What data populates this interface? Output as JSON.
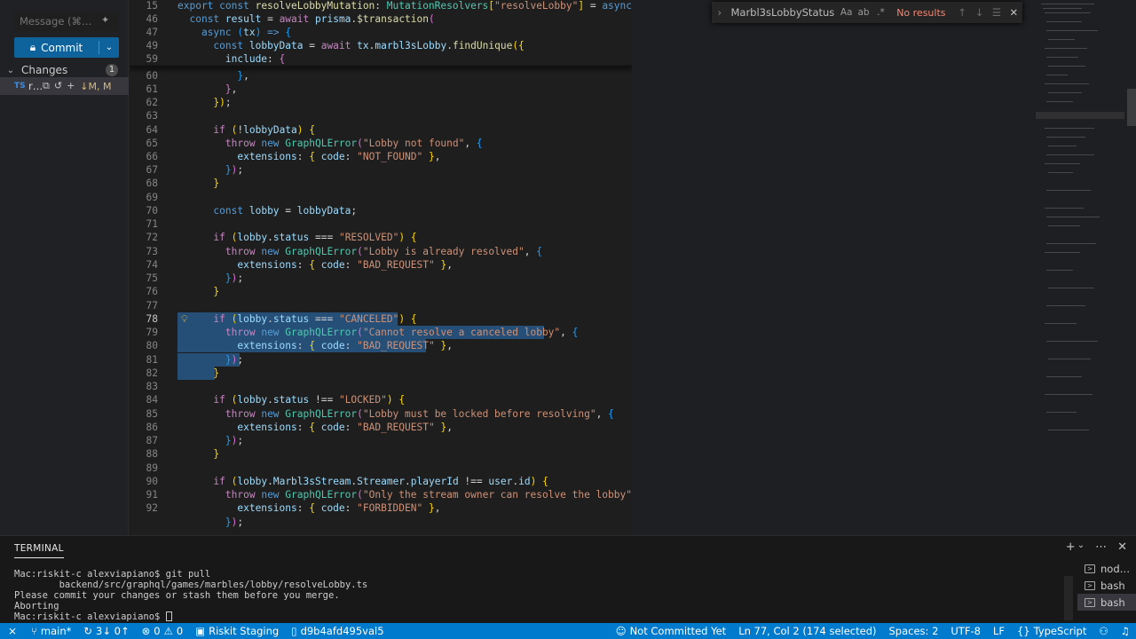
{
  "scm": {
    "message_placeholder": "Message (⌘…",
    "commit_label": "Commit",
    "changes_label": "Changes",
    "changes_count": "1",
    "file": {
      "lang": "TS",
      "name": "r…",
      "status": "↓M, M"
    }
  },
  "find": {
    "query": "Marbl3sLobbyStatus",
    "opt_case": "Aa",
    "opt_word": "ab",
    "opt_regex": ".*",
    "result": "No results"
  },
  "editor": {
    "lines": [
      {
        "n": "15",
        "top": 0
      },
      {
        "n": "46"
      },
      {
        "n": "47"
      },
      {
        "n": "49"
      },
      {
        "n": "59"
      },
      {
        "n": "60"
      },
      {
        "n": "61"
      },
      {
        "n": "62"
      },
      {
        "n": "63"
      },
      {
        "n": "64"
      },
      {
        "n": "65"
      },
      {
        "n": "66"
      },
      {
        "n": "67"
      },
      {
        "n": "68"
      },
      {
        "n": "69"
      },
      {
        "n": "70"
      },
      {
        "n": "71"
      },
      {
        "n": "72"
      },
      {
        "n": "73"
      },
      {
        "n": "74"
      },
      {
        "n": "75"
      },
      {
        "n": "76"
      },
      {
        "n": "77"
      },
      {
        "n": "78"
      },
      {
        "n": "79"
      },
      {
        "n": "80"
      },
      {
        "n": "81"
      },
      {
        "n": "82"
      },
      {
        "n": "83"
      },
      {
        "n": "84"
      },
      {
        "n": "85"
      },
      {
        "n": "86"
      },
      {
        "n": "87"
      },
      {
        "n": "88"
      },
      {
        "n": "89"
      },
      {
        "n": "90"
      },
      {
        "n": "91"
      },
      {
        "n": "92"
      }
    ]
  },
  "terminal": {
    "tab_label": "TERMINAL",
    "lines": [
      "Mac:riskit-c alexviapiano$ git pull",
      "        backend/src/graphql/games/marbles/lobby/resolveLobby.ts",
      "Please commit your changes or stash them before you merge.",
      "Aborting",
      "Mac:riskit-c alexviapiano$ "
    ],
    "sessions": [
      "nod…",
      "bash",
      "bash"
    ]
  },
  "status": {
    "branch": "main*",
    "sync": "3↓ 0↑",
    "errors": "0",
    "warnings": "0",
    "profile": "Riskit Staging",
    "commit": "d9b4afd495val5",
    "not_committed": "Not Committed Yet",
    "cursor": "Ln 77, Col 2 (174 selected)",
    "spaces": "Spaces: 2",
    "encoding": "UTF-8",
    "eol": "LF",
    "language": "TypeScript"
  }
}
